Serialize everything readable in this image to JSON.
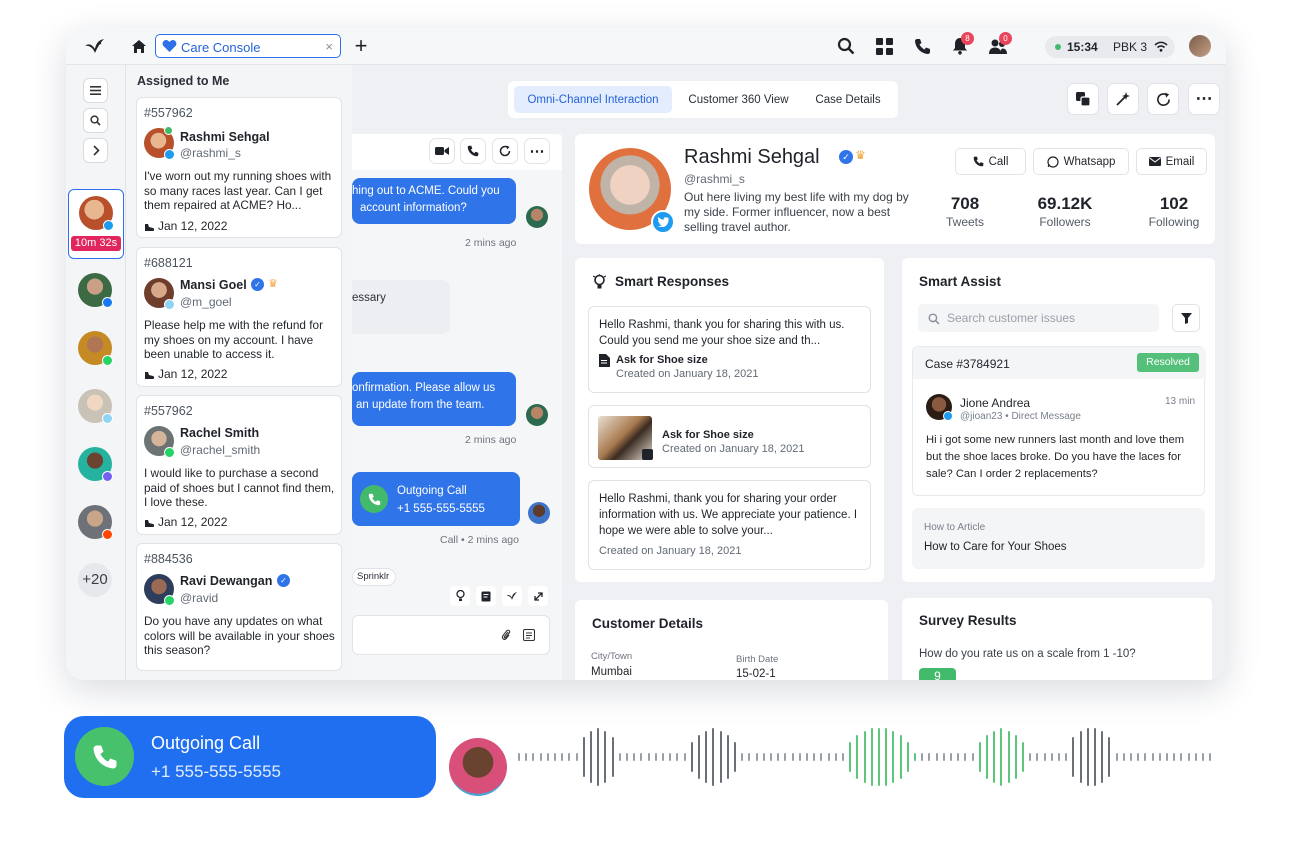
{
  "topbar": {
    "tab_label": "Care Console",
    "tab_close": "×",
    "add_tab": "+",
    "time": "15:34",
    "agent_code": "PBK 3",
    "notif_badge": "8",
    "team_badge": "0"
  },
  "rail": {
    "active_timer": "10m 32s",
    "more_count": "+20"
  },
  "assigned": {
    "title": "Assigned to Me",
    "cards": [
      {
        "id": "#557962",
        "name": "Rashmi Sehgal",
        "handle": "@rashmi_s",
        "message": "I've worn out my running shoes with so many races last year. Can I get them repaired at ACME? Ho...",
        "date": "Jan 12, 2022"
      },
      {
        "id": "#688121",
        "name": "Mansi Goel",
        "handle": "@m_goel",
        "message": "Please help me with the refund for my shoes on my account. I have been unable to access it.",
        "date": "Jan 12, 2022"
      },
      {
        "id": "#557962",
        "name": "Rachel Smith",
        "handle": "@rachel_smith",
        "message": "I would like to purchase a second paid of shoes but I cannot find them, I love these.",
        "date": "Jan 12, 2022"
      },
      {
        "id": "#884536",
        "name": "Ravi Dewangan",
        "handle": "@ravid",
        "message": "Do you have any updates on what colors will be available in your shoes this season?",
        "date": ""
      }
    ]
  },
  "chat": {
    "msg1_line1": "hing out to ACME. Could you",
    "msg1_line2": "account information?",
    "msg1_time": "2 mins ago",
    "msg2": "essary",
    "msg3_line1": "onfirmation. Please allow us",
    "msg3_line2": "an update from the team.",
    "msg3_time": "2 mins ago",
    "call_title": "Outgoing Call",
    "call_number": "+1 555-555-5555",
    "call_meta": "Call • 2 mins ago",
    "tag": "Sprinklr"
  },
  "tabs": {
    "omni": "Omni-Channel Interaction",
    "c360": "Customer 360 View",
    "case": "Case Details"
  },
  "profile": {
    "name": "Rashmi Sehgal",
    "handle": "@rashmi_s",
    "bio": "Out here living my best life with my dog by my side. Former influencer, now a best selling travel author.",
    "call_btn": "Call",
    "whatsapp_btn": "Whatsapp",
    "email_btn": "Email",
    "stats": [
      {
        "value": "708",
        "label": "Tweets"
      },
      {
        "value": "69.12K",
        "label": "Followers"
      },
      {
        "value": "102",
        "label": "Following"
      }
    ]
  },
  "smart_responses": {
    "title": "Smart Responses",
    "items": [
      {
        "text": "Hello Rashmi, thank you for sharing this with us. Could you send me your shoe size and th...",
        "attach": "Ask for Shoe size",
        "created": "Created on January 18, 2021"
      },
      {
        "attach": "Ask for Shoe size",
        "created": "Created on January 18, 2021"
      },
      {
        "text": "Hello Rashmi, thank you for sharing your order information with us. We appreciate your patience. I hope we were able to solve your...",
        "created": "Created on January 18, 2021"
      }
    ]
  },
  "smart_assist": {
    "title": "Smart Assist",
    "search_placeholder": "Search customer issues",
    "case_id": "Case #3784921",
    "case_status": "Resolved",
    "author": "Jione Andrea",
    "author_meta": "@jioan23 • Direct Message",
    "time": "13 min",
    "message": "Hi i got some new runners last month and love them but the shoe laces broke. Do you have the laces for sale? Can I order 2 replacements?",
    "article_kind": "How to Article",
    "article_title": "How to Care for Your Shoes"
  },
  "customer_details": {
    "title": "Customer Details",
    "city_label": "City/Town",
    "city": "Mumbai",
    "birth_label": "Birth Date",
    "birth": "15-02-1"
  },
  "survey": {
    "title": "Survey Results",
    "question": "How do you rate us on a scale from 1 -10?",
    "score": "9"
  },
  "bottom_call": {
    "title": "Outgoing Call",
    "number": "+1 555-555-5555"
  },
  "colors": {
    "brand_blue": "#2f74e8",
    "green": "#43b96b",
    "resolved": "#55c07a"
  }
}
